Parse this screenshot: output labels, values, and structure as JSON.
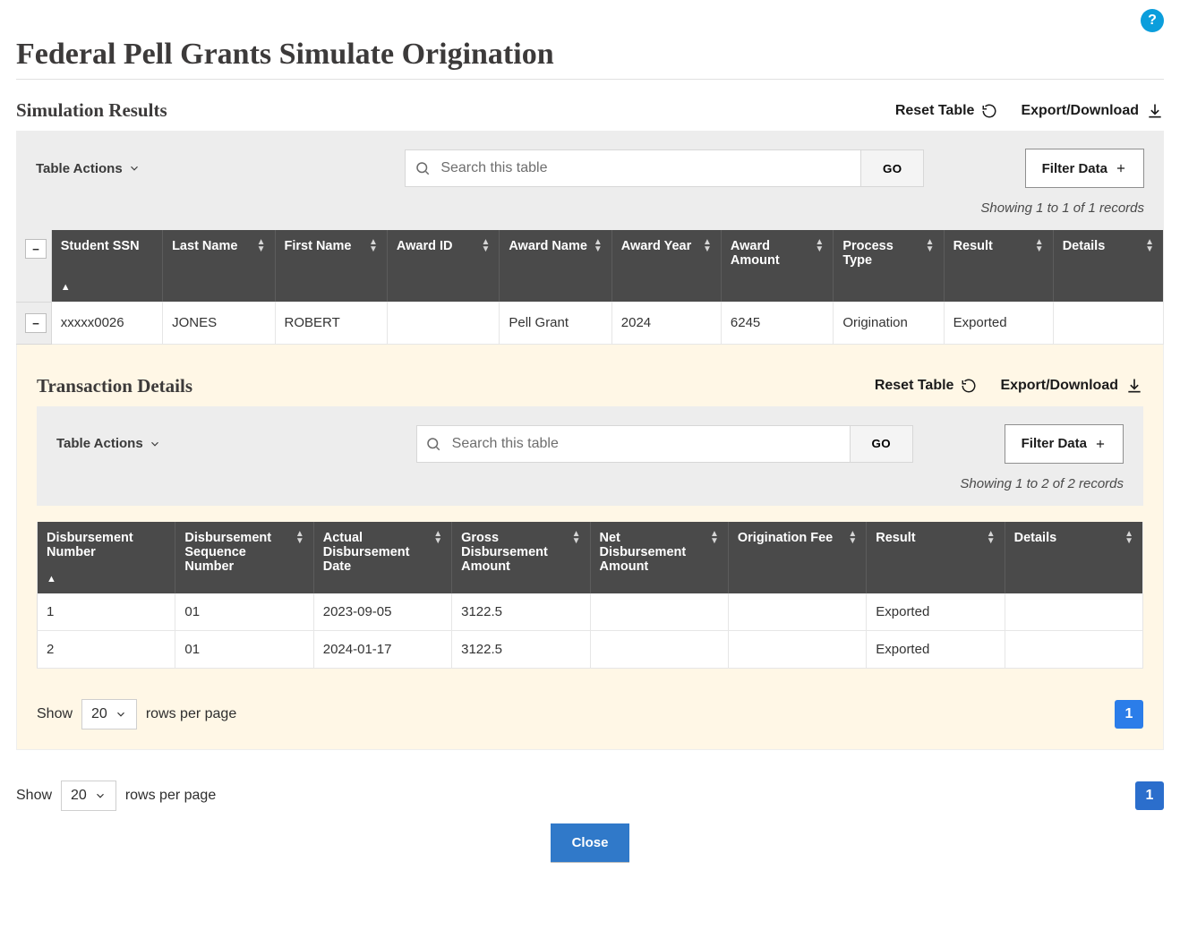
{
  "help_label": "?",
  "page_title": "Federal Pell Grants Simulate Origination",
  "close_label": "Close",
  "common": {
    "table_actions": "Table Actions",
    "reset_table": "Reset Table",
    "export_download": "Export/Download",
    "go": "GO",
    "filter_data": "Filter Data",
    "search_placeholder": "Search this table",
    "show": "Show",
    "rows_per_page": "rows per page",
    "page_size": "20",
    "current_page": "1"
  },
  "results": {
    "section_title": "Simulation Results",
    "showing_text": "Showing 1 to 1 of 1 records",
    "columns": {
      "student_ssn": "Student SSN",
      "last_name": "Last Name",
      "first_name": "First Name",
      "award_id": "Award ID",
      "award_name": "Award Name",
      "award_year": "Award Year",
      "award_amount": "Award Amount",
      "process_type": "Process Type",
      "result": "Result",
      "details": "Details"
    },
    "rows": [
      {
        "student_ssn": "xxxxx0026",
        "last_name": "JONES",
        "first_name": "ROBERT",
        "award_id": "",
        "award_name": "Pell Grant",
        "award_year": "2024",
        "award_amount": "6245",
        "process_type": "Origination",
        "result": "Exported",
        "details": ""
      }
    ]
  },
  "transaction": {
    "section_title": "Transaction Details",
    "showing_text": "Showing 1 to 2 of 2 records",
    "columns": {
      "disb_number": "Disbursement Number",
      "disb_seq": "Disbursement Sequence Number",
      "actual_date": "Actual Disbursement Date",
      "gross_amount": "Gross Disbursement Amount",
      "net_amount": "Net Disbursement Amount",
      "orig_fee": "Origination Fee",
      "result": "Result",
      "details": "Details"
    },
    "rows": [
      {
        "disb_number": "1",
        "disb_seq": "01",
        "actual_date": "2023-09-05",
        "gross_amount": "3122.5",
        "net_amount": "",
        "orig_fee": "",
        "result": "Exported",
        "details": ""
      },
      {
        "disb_number": "2",
        "disb_seq": "01",
        "actual_date": "2024-01-17",
        "gross_amount": "3122.5",
        "net_amount": "",
        "orig_fee": "",
        "result": "Exported",
        "details": ""
      }
    ]
  }
}
